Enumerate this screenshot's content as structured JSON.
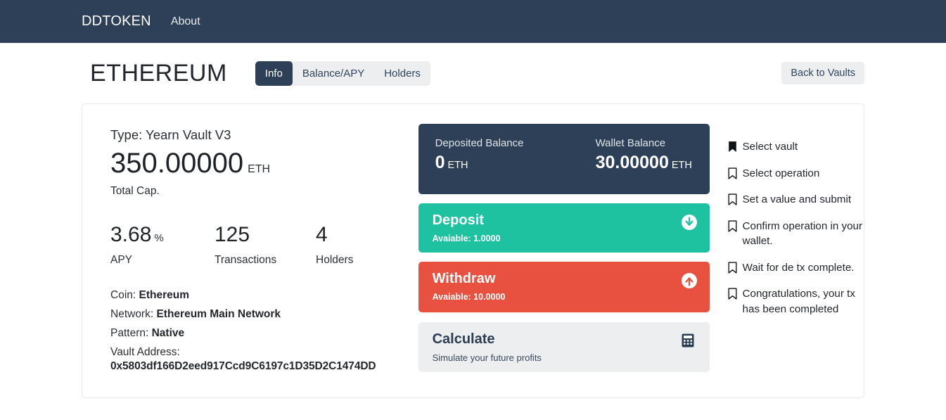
{
  "navbar": {
    "brand": "DDTOKEN",
    "about_label": "About"
  },
  "header": {
    "vault_title": "ETHEREUM",
    "tabs": [
      {
        "label": "Info",
        "active": true
      },
      {
        "label": "Balance/APY",
        "active": false
      },
      {
        "label": "Holders",
        "active": false
      }
    ],
    "back_button": "Back to Vaults"
  },
  "info": {
    "type_line": "Type: Yearn Vault V3",
    "total_cap_value": "350.00000",
    "total_cap_unit": "ETH",
    "total_cap_label": "Total Cap.",
    "stats": [
      {
        "value": "3.68",
        "suffix": "%",
        "label": "APY"
      },
      {
        "value": "125",
        "suffix": "",
        "label": "Transactions"
      },
      {
        "value": "4",
        "suffix": "",
        "label": "Holders"
      }
    ],
    "coin_label": "Coin:",
    "coin_value": "Ethereum",
    "network_label": "Network:",
    "network_value": "Ethereum Main Network",
    "pattern_label": "Pattern:",
    "pattern_value": "Native",
    "vault_address_label": "Vault Address:",
    "vault_address": "0x5803df166D2eed917Ccd9C6197c1D35D2C1474DD"
  },
  "balances": {
    "deposited_label": "Deposited Balance",
    "deposited_value": "0",
    "deposited_unit": "ETH",
    "wallet_label": "Wallet Balance",
    "wallet_value": "30.00000",
    "wallet_unit": "ETH"
  },
  "actions": {
    "deposit": {
      "title": "Deposit",
      "subtitle": "Avaiable: 1.0000",
      "icon": "arrow-down-circle-icon",
      "color": "#1ec2a0"
    },
    "withdraw": {
      "title": "Withdraw",
      "subtitle": "Avaiable: 10.0000",
      "icon": "arrow-up-circle-icon",
      "color": "#e8503f"
    },
    "calculate": {
      "title": "Calculate",
      "subtitle": "Simulate your future profits",
      "icon": "calculator-icon",
      "color": "#eceef0"
    }
  },
  "steps": [
    {
      "text": "Select vault",
      "icon": "bookmark-filled-icon",
      "done": true
    },
    {
      "text": "Select operation",
      "icon": "bookmark-outline-icon",
      "done": false
    },
    {
      "text": "Set a value and submit",
      "icon": "bookmark-outline-icon",
      "done": false
    },
    {
      "text": "Confirm operation in your wallet.",
      "icon": "bookmark-outline-icon",
      "done": false
    },
    {
      "text": "Wait for de tx complete.",
      "icon": "bookmark-outline-icon",
      "done": false
    },
    {
      "text": "Congratulations, your tx has been completed",
      "icon": "bookmark-outline-icon",
      "done": false
    }
  ],
  "theme": {
    "navbar_bg": "#2e4057",
    "panel_dark": "#2e4057",
    "deposit_green": "#1ec2a0",
    "withdraw_red": "#e8503f",
    "light_gray": "#eceef0"
  }
}
